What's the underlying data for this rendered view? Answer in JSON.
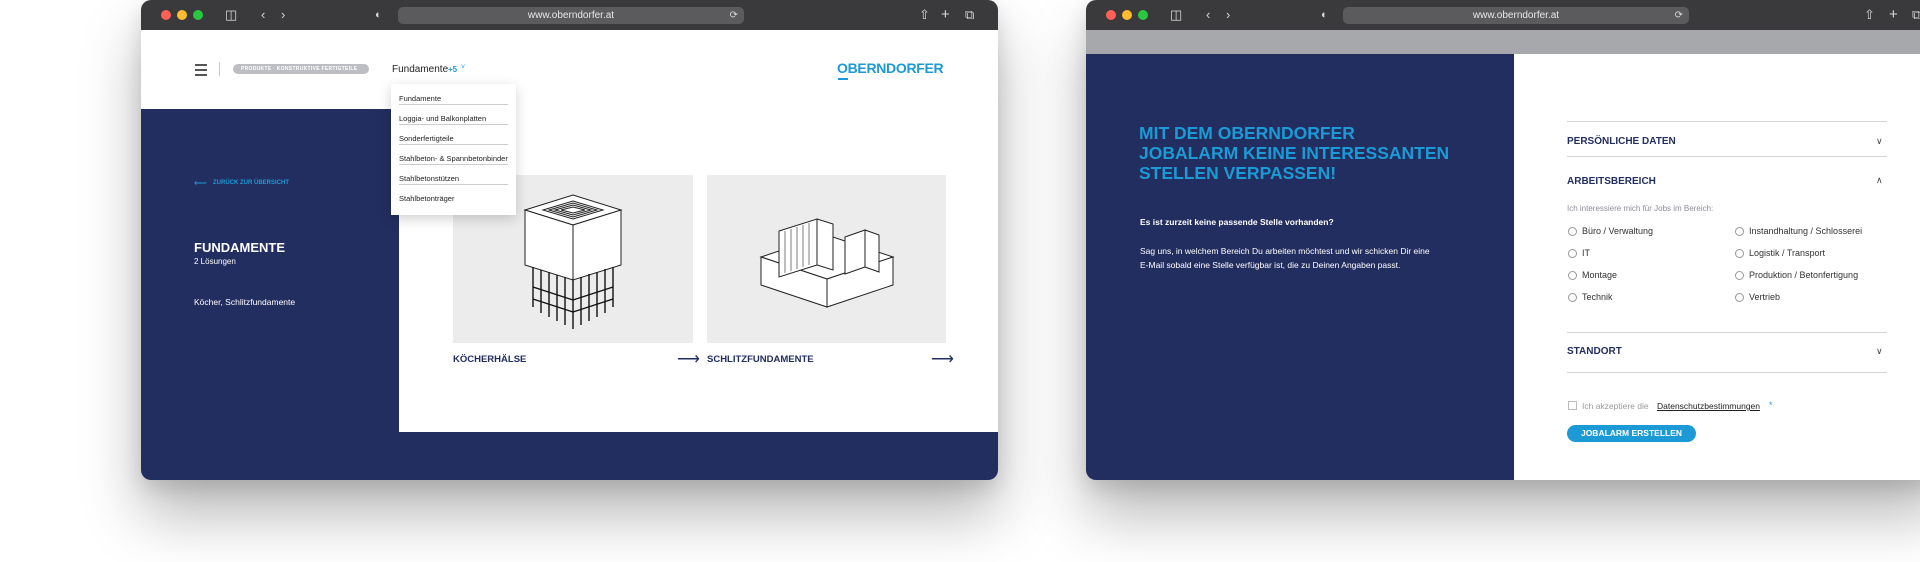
{
  "browser": {
    "url": "www.oberndorfer.at"
  },
  "left_page": {
    "breadcrumb": "PRODUKTE · KONSTRUKTIVE FERTIGTEILE",
    "nav_current": "Fundamente",
    "nav_more": "+5",
    "logo": "OBERNDORFER",
    "dropdown": [
      "Fundamente",
      "Loggia- und Balkonplatten",
      "Sonderfertigteile",
      "Stahlbeton- & Spannbetonbinder",
      "Stahlbetonstützen",
      "Stahlbetonträger"
    ],
    "back_link": "ZURÜCK ZUR ÜBERSICHT",
    "title": "FUNDAMENTE",
    "subtitle": "2 Lösungen",
    "desc": "Köcher, Schlitzfundamente",
    "cards": [
      {
        "title": "KÖCHERHÄLSE"
      },
      {
        "title": "SCHLITZFUNDAMENTE"
      }
    ],
    "colors": {
      "navy": "#232e60",
      "accent": "#1c9ad6"
    }
  },
  "right_page": {
    "headline": [
      "MIT DEM OBERNDORFER",
      "JOBALARM KEINE INTERESSANTEN",
      "STELLEN VERPASSEN!"
    ],
    "question": "Es ist zurzeit keine passende Stelle vorhanden?",
    "body_line1": "Sag uns, in welchem Bereich Du arbeiten möchtest und wir schicken Dir eine",
    "body_line2": "E-Mail sobald eine Stelle verfügbar ist, die zu Deinen Angaben passt.",
    "sections": {
      "personal": "PERSÖNLICHE DATEN",
      "work": "ARBEITSBEREICH",
      "location": "STANDORT"
    },
    "work_hint": "Ich interessiere mich für Jobs im Bereich:",
    "options_left": [
      "Büro / Verwaltung",
      "IT",
      "Montage",
      "Technik"
    ],
    "options_right": [
      "Instandhaltung / Schlosserei",
      "Logistik / Transport",
      "Produktion / Betonfertigung",
      "Vertrieb"
    ],
    "consent_prefix": "Ich akzeptiere die",
    "consent_link": "Datenschutzbestimmungen",
    "consent_required": "*",
    "submit": "JOBALARM ERSTELLEN"
  }
}
